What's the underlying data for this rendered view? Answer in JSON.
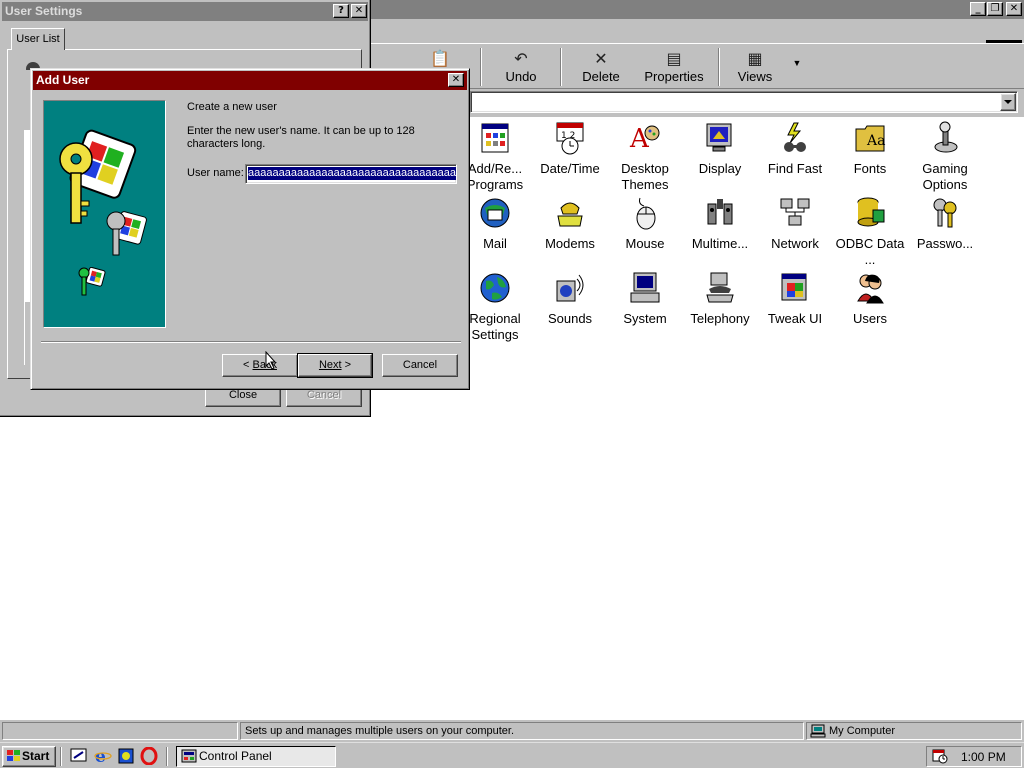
{
  "control_panel": {
    "toolbar": {
      "undo": "Undo",
      "delete": "Delete",
      "properties": "Properties",
      "views": "Views"
    },
    "icons": [
      {
        "label": "Add/Re... Programs",
        "icon": "add-remove-programs-icon"
      },
      {
        "label": "Date/Time",
        "icon": "date-time-icon"
      },
      {
        "label": "Desktop Themes",
        "icon": "desktop-themes-icon"
      },
      {
        "label": "Display",
        "icon": "display-icon"
      },
      {
        "label": "Find Fast",
        "icon": "find-fast-icon"
      },
      {
        "label": "Fonts",
        "icon": "fonts-icon"
      },
      {
        "label": "Gaming Options",
        "icon": "gaming-options-icon"
      },
      {
        "label": "Mail",
        "icon": "mail-icon"
      },
      {
        "label": "Modems",
        "icon": "modems-icon"
      },
      {
        "label": "Mouse",
        "icon": "mouse-icon"
      },
      {
        "label": "Multime...",
        "icon": "multimedia-icon"
      },
      {
        "label": "Network",
        "icon": "network-icon"
      },
      {
        "label": "ODBC Data ...",
        "icon": "odbc-icon"
      },
      {
        "label": "Passwo...",
        "icon": "passwords-icon"
      },
      {
        "label": "Regional Settings",
        "icon": "regional-settings-icon"
      },
      {
        "label": "Sounds",
        "icon": "sounds-icon"
      },
      {
        "label": "System",
        "icon": "system-icon"
      },
      {
        "label": "Telephony",
        "icon": "telephony-icon"
      },
      {
        "label": "Tweak UI",
        "icon": "tweak-ui-icon"
      },
      {
        "label": "Users",
        "icon": "users-icon"
      }
    ]
  },
  "statusbar": {
    "description": "Sets up and manages multiple users on your computer.",
    "location": "My Computer"
  },
  "taskbar": {
    "start": "Start",
    "task": "Control Panel",
    "clock": "1:00 PM"
  },
  "user_settings": {
    "title": "User Settings",
    "tab": "User List",
    "close": "Close",
    "cancel": "Cancel"
  },
  "add_user": {
    "title": "Add User",
    "heading": "Create a new user",
    "instructions": "Enter the new user's name. It can be up to 128 characters long.",
    "field_label": "User name:",
    "field_value": "aaaaaaaaaaaaaaaaaaaaaaaaaaaaaaaaaaaaaaaaaaaaa",
    "back_prefix": "< ",
    "back": "Back",
    "next": "Next",
    "next_suffix": " >",
    "cancel": "Cancel"
  },
  "colors": {
    "face": "#c0c0c0",
    "active_title": "#800000",
    "inactive_title": "#808080",
    "art_bg": "#008080",
    "selection": "#000080"
  }
}
